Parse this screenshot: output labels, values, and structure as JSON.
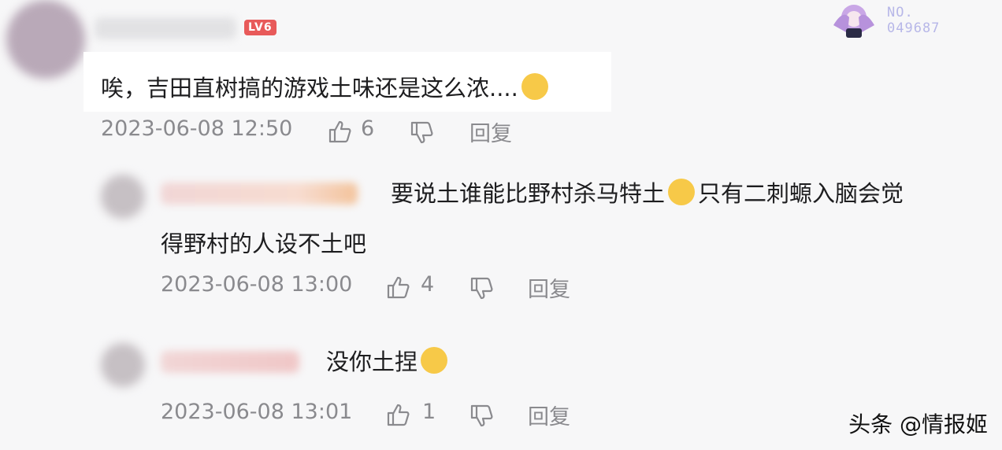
{
  "top_comment": {
    "level_badge": "LV6",
    "text": "唉，吉田直树搞的游戏土味还是这么浓....",
    "emoji": "sweat-face-emoji",
    "time": "2023-06-08 12:50",
    "likes": "6",
    "reply_label": "回复"
  },
  "badge": {
    "label": "NO.",
    "number": "049687"
  },
  "reply_1": {
    "text_line1": "要说土谁能比野村杀马特土",
    "emoji": "crying-face-emoji",
    "text_line1b": "只有二刺螈入脑会觉",
    "text_line2": "得野村的人设不土吧",
    "time": "2023-06-08 13:00",
    "likes": "4",
    "reply_label": "回复"
  },
  "reply_2": {
    "text": "没你土捏",
    "emoji": "screaming-face-emoji",
    "time": "2023-06-08 13:01",
    "likes": "1",
    "reply_label": "回复"
  },
  "watermark": "头条 @情报姬",
  "colors": {
    "accent_red": "#e85a5a",
    "meta_gray": "#8a8a8e",
    "emoji_yellow": "#f7c948"
  }
}
